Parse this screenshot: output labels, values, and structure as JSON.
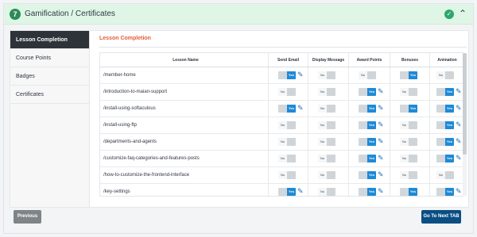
{
  "header": {
    "step": "7",
    "title": "Gamification / Certificates"
  },
  "sidebar": {
    "items": [
      {
        "label": "Lesson Completion"
      },
      {
        "label": "Course Points"
      },
      {
        "label": "Badges"
      },
      {
        "label": "Certificates"
      }
    ]
  },
  "section": {
    "title": "Lesson Completion"
  },
  "table": {
    "headers": [
      "Lesson Name",
      "Send Email",
      "Display Message",
      "Award Points",
      "Bonuses",
      "Animation"
    ],
    "rows": [
      {
        "name": "/member-home",
        "values": [
          "Yes",
          "No",
          "No",
          "Yes",
          "No"
        ]
      },
      {
        "name": "/introduction-to-maian-support",
        "values": [
          "No",
          "No",
          "Yes",
          "No",
          "Yes"
        ]
      },
      {
        "name": "/install-using-softaculous",
        "values": [
          "Yes",
          "No",
          "Yes",
          "Yes",
          "Yes"
        ]
      },
      {
        "name": "/install-using-ftp",
        "values": [
          "No",
          "No",
          "Yes",
          "No",
          "Yes"
        ]
      },
      {
        "name": "/departments-and-agents",
        "values": [
          "No",
          "No",
          "Yes",
          "No",
          "Yes"
        ]
      },
      {
        "name": "/customize-faq-categories-and-features-posts",
        "values": [
          "No",
          "No",
          "Yes",
          "No",
          "Yes"
        ]
      },
      {
        "name": "/how-to-customize-the-frontend-interface",
        "values": [
          "No",
          "No",
          "Yes",
          "No",
          "No"
        ]
      },
      {
        "name": "/key-settings",
        "values": [
          "Yes",
          "No",
          "Yes",
          "Yes",
          "Yes"
        ]
      }
    ]
  },
  "footer": {
    "previous": "Previous",
    "next": "Go To Next TAB"
  },
  "colors": {
    "accent": "#1f8ad6",
    "success": "#2ea76a",
    "section_title": "#e35c37"
  }
}
